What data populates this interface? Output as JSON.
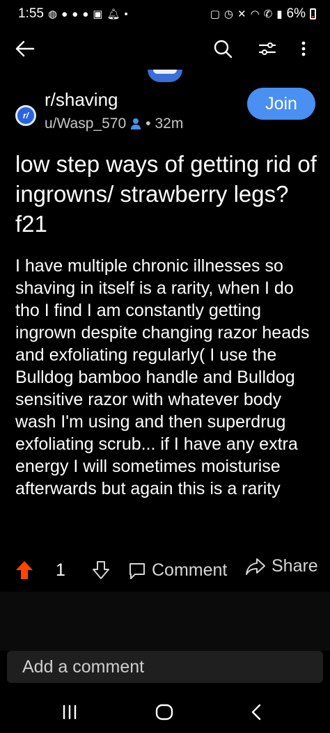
{
  "status_bar": {
    "time": "1:55",
    "battery": "6%",
    "left_icons": [
      "messenger-icon",
      "facebook-icon",
      "facebook-icon",
      "pinterest-icon",
      "gallery-icon",
      "notification-bell-icon",
      "dot-icon"
    ],
    "right_icons": [
      "lock-icon",
      "alarm-icon",
      "mute-icon",
      "wifi-icon",
      "call-icon",
      "signal-icon",
      "battery-icon"
    ]
  },
  "nav": {
    "back_icon": "back-arrow-icon",
    "search_icon": "search-icon",
    "filter_icon": "sort-filter-icon",
    "more_icon": "more-vertical-icon"
  },
  "post": {
    "subreddit": "r/shaving",
    "subreddit_icon_text": "r/",
    "author": "u/Wasp_570",
    "separator": "•",
    "age": "32m",
    "join_label": "Join",
    "title": "low step ways of getting rid of ingrowns/ strawberry legs? f21",
    "body": "I have multiple chronic illnesses so shaving in itself is a rarity, when I do tho I find I am constantly getting ingrown despite changing razor heads and exfoliating regularly( I use the Bulldog bamboo handle and Bulldog sensitive razor with whatever body wash I'm using and then superdrug exfoliating scrub... if I have any extra energy I will sometimes moisturise afterwards but again this is a rarity"
  },
  "actions": {
    "vote_count": "1",
    "comment_label": "Comment",
    "share_label": "Share"
  },
  "comment_box": {
    "placeholder": "Add a comment"
  },
  "colors": {
    "background": "#000000",
    "join_button": "#4a8ff2",
    "upvote_active": "#ff4500",
    "subreddit_icon": "#2a64dd"
  }
}
